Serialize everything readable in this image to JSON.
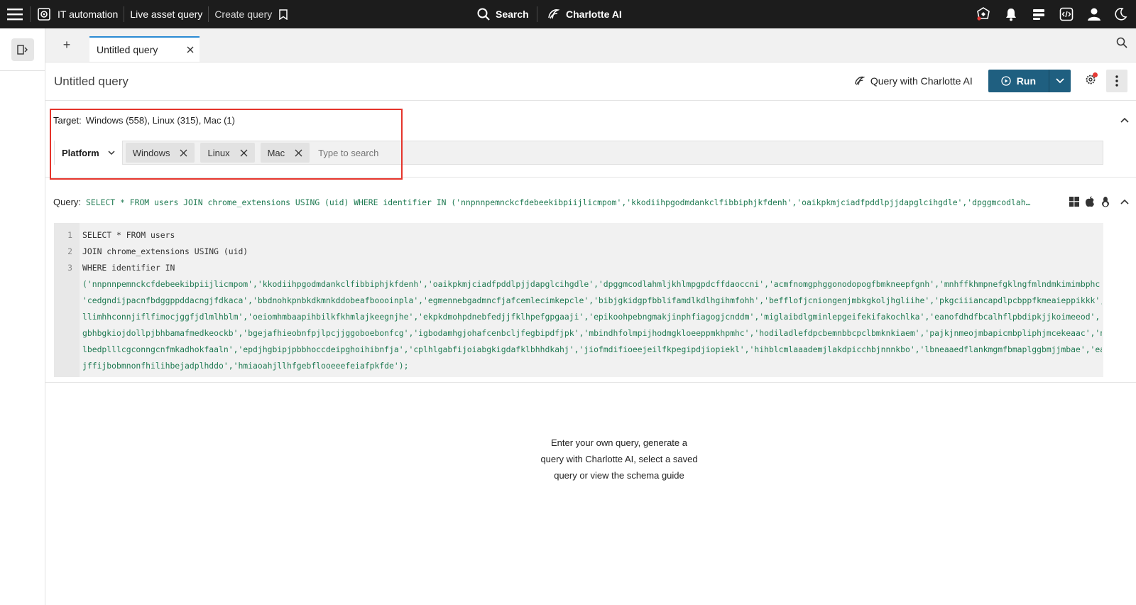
{
  "topbar": {
    "app_name": "IT automation",
    "nav_live": "Live asset query",
    "nav_create": "Create query",
    "search_label": "Search",
    "charlotte_label": "Charlotte AI"
  },
  "tabs": {
    "add_label": "+",
    "active_tab": "Untitled query"
  },
  "header": {
    "title": "Untitled query",
    "charlotte_button": "Query with Charlotte AI",
    "run_label": "Run"
  },
  "target": {
    "label": "Target:",
    "summary": "Windows (558), Linux (315), Mac (1)",
    "filter_field": "Platform",
    "chips": [
      "Windows",
      "Linux",
      "Mac"
    ],
    "search_placeholder": "Type to search"
  },
  "query": {
    "label": "Query:",
    "inline_preview": "SELECT * FROM users JOIN chrome_extensions USING (uid) WHERE identifier IN ('nnpnnpemnckcfdebeekibpiijlicmpom','kkodiihpgodmdankclfibbiphjkfdenh','oaikpkmjciadfpddlpjjdapglcihgdle','dpggmcodlahml…",
    "line_numbers": [
      "1",
      "2",
      "3"
    ],
    "lines": [
      "SELECT * FROM users",
      "JOIN chrome_extensions USING (uid)",
      "WHERE identifier IN",
      "('nnpnnpemnckcfdebeekibpiijlicmpom','kkodiihpgodmdankclfibbiphjkfdenh','oaikpkmjciadfpddlpjjdapglcihgdle','dpggmcodlahmljkhlmpgpdcffdaoccni','acmfnomgphggonodopogfbmkneepfgnh','mnhffkhmpnefgklngfmlndmkimimbphc',",
      "'cedgndijpacnfbdggppddacngjfdkaca','bbdnohkpnbkdkmnkddobeafboooinpla','egmennebgadmncfjafcemlecimkepcle','bibjgkidgpfbblifamdlkdlhgihmfohh','befflofjcniongenjmbkgkoljhgliihe','pkgciiiancapdlpcbppfkmeaieppikkk','",
      "llimhhconnjiflfimocjggfjdlmlhblm','oeiomhmbaapihbilkfkhmlajkeegnjhe','ekpkdmohpdnebfedjjfklhpefgpgaaji','epikoohpebngmakjinphfiagogjcnddm','miglaibdlgminlepgeifekifakochlka','eanofdhdfbcalhflpbdipkjjkoimeeod','o",
      "gbhbgkiojdollpjbhbamafmedkeockb','bgejafhieobnfpjlpcjjggoboebonfcg','igbodamhgjohafcenbcljfegbipdfjpk','mbindhfolmpijhodmgkloeeppmkhpmhc','hodiladlefdpcbemnbbcpclbmknkiaem','pajkjnmeojmbapicmbpliphjmcekeaac','nd",
      "lbedplllcgconngcnfmkadhokfaaln','epdjhgbipjpbbhoccdeipghoihibnfja','cplhlgabfijoiabgkigdafklbhhdkahj','jiofmdifioeejeilfkpegipdjiopiekl','hihblcmlaaademjlakdpicchbjnnnkbo','lbneaaedflankmgmfbmaplggbmjjmbae','eai",
      "jffijbobmnonfhilihbejadplhddo','hmiaoahjllhfgebflooeeefeiafpkfde');"
    ]
  },
  "empty_state": {
    "message": "Enter your own query, generate a query with Charlotte AI, select a saved query or view the schema guide"
  }
}
